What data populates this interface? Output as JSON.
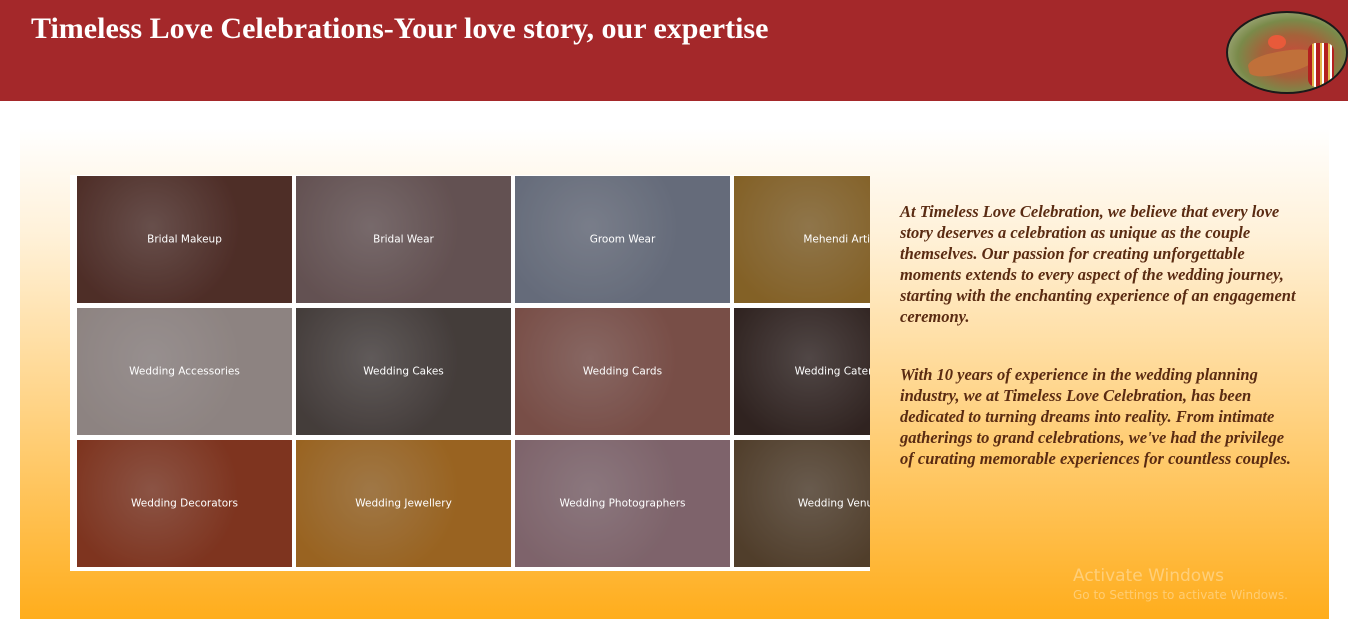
{
  "header": {
    "title": "Timeless Love Celebrations-Your love story, our expertise",
    "logo_icon": "bride-hand-mehendi-logo"
  },
  "gallery": {
    "tiles": [
      {
        "label": "Bridal Makeup",
        "bg": "#6b3b2c"
      },
      {
        "label": "Bridal Wear",
        "bg": "#8a6f6a"
      },
      {
        "label": "Groom Wear",
        "bg": "#8d96a6"
      },
      {
        "label": "Mehendi Artist",
        "bg": "#b9862a"
      },
      {
        "label": "Wedding Accessories",
        "bg": "#c8b9b0"
      },
      {
        "label": "Wedding Cakes",
        "bg": "#5c5148"
      },
      {
        "label": "Wedding Cards",
        "bg": "#a96a5a"
      },
      {
        "label": "Wedding Caterers",
        "bg": "#3e2b21"
      },
      {
        "label": "Wedding Decorators",
        "bg": "#b1441f"
      },
      {
        "label": "Wedding Jewellery",
        "bg": "#d98a22"
      },
      {
        "label": "Wedding Photographers",
        "bg": "#b18a8f"
      },
      {
        "label": "Wedding Venues",
        "bg": "#6e5331"
      }
    ]
  },
  "about": {
    "paragraph1": "At Timeless Love Celebration, we believe that every love story deserves a celebration as unique as the couple themselves. Our passion for creating unforgettable moments extends to every aspect of the wedding journey, starting with the enchanting experience of an engagement ceremony.",
    "paragraph2": "With 10 years of experience in the wedding planning industry, we at Timeless Love Celebration, has been dedicated to turning dreams into reality. From intimate gatherings to grand celebrations, we've had the privilege of curating memorable experiences for countless couples."
  },
  "watermark": {
    "line1": "Activate Windows",
    "line2": "Go to Settings to activate Windows."
  },
  "colors": {
    "header_bg": "#a4282a",
    "text_brown": "#5a2b12",
    "gradient_bottom": "#ffad1c"
  }
}
